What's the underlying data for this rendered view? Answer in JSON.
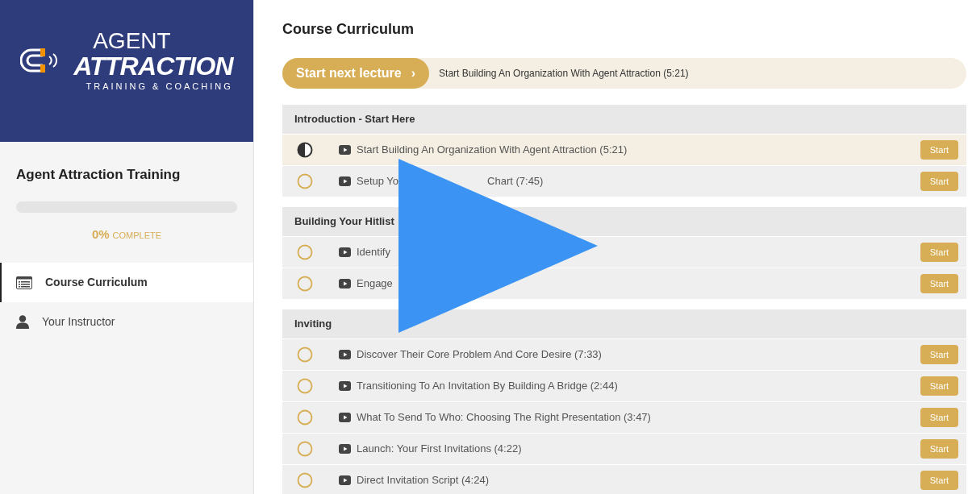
{
  "sidebar": {
    "logo": {
      "line_1": "AGENT",
      "line_2": "ATTRACTION",
      "line_3": "TRAINING & COACHING"
    },
    "course_title": "Agent Attraction Training",
    "progress": {
      "level": 0,
      "percent": "0%",
      "label": "COMPLETE"
    },
    "nav": [
      {
        "label": "Course Curriculum",
        "kind": "list",
        "selected": true
      },
      {
        "label": "Your Instructor",
        "kind": "person",
        "selected": false
      }
    ]
  },
  "main": {
    "title": "Course Curriculum",
    "next_lecture": {
      "button": "Start next lecture",
      "chevron": "›",
      "lecture": "Start Building An Organization With Agent Attraction (5:21)"
    },
    "sections": [
      {
        "title": "Introduction - Start Here",
        "lectures": [
          {
            "title": "Start Building An Organization With Agent Attraction (5:21)",
            "started": true,
            "current": true,
            "button": "Start"
          },
          {
            "title": "Setup Yo",
            "title_tail": "Chart (7:45)",
            "started": false,
            "current": false,
            "button": "Start"
          }
        ]
      },
      {
        "title": "Building Your Hitlist",
        "lectures": [
          {
            "title": "Identify",
            "started": false,
            "current": false,
            "button": "Start"
          },
          {
            "title": "Engage",
            "started": false,
            "current": false,
            "button": "Start"
          }
        ]
      },
      {
        "title": "Inviting",
        "lectures": [
          {
            "title": "Discover Their Core Problem And Core Desire (7:33)",
            "started": false,
            "current": false,
            "button": "Start"
          },
          {
            "title": "Transitioning To An Invitation By Building A Bridge (2:44)",
            "started": false,
            "current": false,
            "button": "Start"
          },
          {
            "title": "What To Send To Who: Choosing The Right Presentation (3:47)",
            "started": false,
            "current": false,
            "button": "Start"
          },
          {
            "title": "Launch: Your First Invitations (4:22)",
            "started": false,
            "current": false,
            "button": "Start"
          },
          {
            "title": "Direct Invitation Script (4:24)",
            "started": false,
            "current": false,
            "button": "Start"
          }
        ]
      }
    ]
  }
}
